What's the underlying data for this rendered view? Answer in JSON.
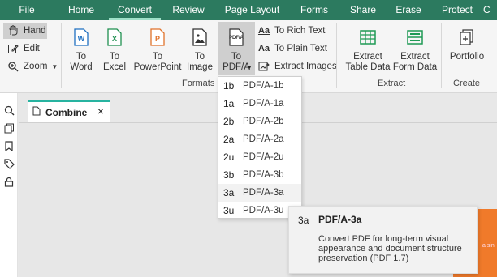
{
  "menu": [
    "File",
    "Home",
    "Convert",
    "Review",
    "Page Layout",
    "Forms",
    "Share",
    "Erase",
    "Protect",
    "C"
  ],
  "tools": {
    "hand": "Hand",
    "edit": "Edit",
    "zoom": "Zoom"
  },
  "convert": {
    "word": "To\nWord",
    "excel": "To\nExcel",
    "powerpoint": "To\nPowerPoint",
    "image": "To\nImage",
    "pdfa": "To\nPDF/A",
    "rich_text": "To Rich Text",
    "plain_text": "To Plain Text",
    "extract_images": "Extract Images",
    "formats_label": "Formats"
  },
  "extract": {
    "table": "Extract\nTable Data",
    "form": "Extract\nForm Data",
    "label": "Extract"
  },
  "create": {
    "portfolio": "Portfolio",
    "label": "Create"
  },
  "tab": {
    "title": "Combine",
    "close": "×"
  },
  "dropdown": [
    {
      "code": "1b",
      "label": "PDF/A-1b"
    },
    {
      "code": "1a",
      "label": "PDF/A-1a"
    },
    {
      "code": "2b",
      "label": "PDF/A-2b"
    },
    {
      "code": "2a",
      "label": "PDF/A-2a"
    },
    {
      "code": "2u",
      "label": "PDF/A-2u"
    },
    {
      "code": "3b",
      "label": "PDF/A-3b"
    },
    {
      "code": "3a",
      "label": "PDF/A-3a"
    },
    {
      "code": "3u",
      "label": "PDF/A-3u"
    }
  ],
  "tooltip": {
    "code": "3a",
    "title": "PDF/A-3a",
    "desc": "Convert PDF for long-term visual appearance and document structure preservation (PDF 1.7)"
  },
  "orange_text": "a sin",
  "colors": {
    "menubar": "#2c7a5f",
    "accent": "#27b3a0",
    "word": "#1f6fc1",
    "excel": "#1e8f4f",
    "ppt": "#e0722a",
    "green": "#1e9a55"
  }
}
